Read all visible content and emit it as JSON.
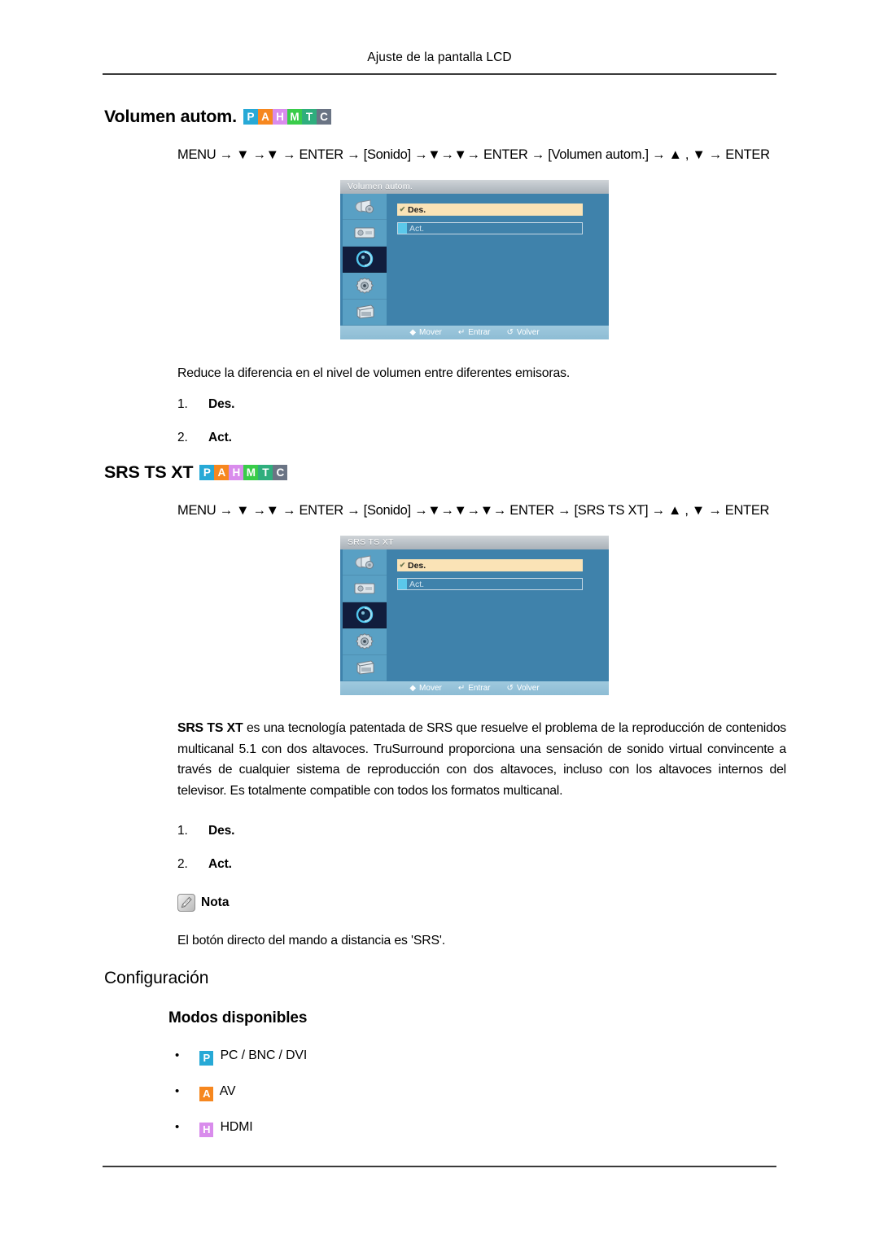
{
  "page": {
    "header": "Ajuste de la pantalla LCD"
  },
  "sections": [
    {
      "id": "volumen-autom",
      "title": "Volumen autom.",
      "badges": [
        {
          "letter": "P",
          "color": "#27a9d6"
        },
        {
          "letter": "A",
          "color": "#f6871f"
        },
        {
          "letter": "H",
          "color": "#d98cec"
        },
        {
          "letter": "M",
          "color": "#39cc4a"
        },
        {
          "letter": "T",
          "color": "#2fae7d"
        },
        {
          "letter": "C",
          "color": "#6a7484"
        }
      ],
      "menu_path": "MENU → ▼ →▼ → ENTER → [Sonido] →▼→▼→ ENTER → [Volumen autom.] → ▲ , ▼ → ENTER",
      "description": "Reduce la diferencia en el nivel de volumen entre diferentes emisoras.",
      "steps": [
        {
          "num": "1.",
          "label": "Des."
        },
        {
          "num": "2.",
          "label": "Act."
        }
      ],
      "osd": {
        "title": "Volumen autom.",
        "option_on": "Des.",
        "option_off": "Act.",
        "check_glyph": "✔",
        "footer": [
          {
            "icon": "move-icon",
            "glyph": "◆",
            "label": "Mover"
          },
          {
            "icon": "enter-icon",
            "glyph": "↵",
            "label": "Entrar"
          },
          {
            "icon": "return-icon",
            "glyph": "↺",
            "label": "Volver"
          }
        ],
        "sidebar_icons": [
          "picture-icon",
          "image-icon",
          "sound-icon",
          "setup-icon",
          "multicontrol-icon"
        ],
        "selected_sidebar_index": 2
      }
    },
    {
      "id": "srs-ts-xt",
      "title": "SRS TS XT",
      "badges": [
        {
          "letter": "P",
          "color": "#27a9d6"
        },
        {
          "letter": "A",
          "color": "#f6871f"
        },
        {
          "letter": "H",
          "color": "#d98cec"
        },
        {
          "letter": "M",
          "color": "#39cc4a"
        },
        {
          "letter": "T",
          "color": "#2fae7d"
        },
        {
          "letter": "C",
          "color": "#6a7484"
        }
      ],
      "menu_path": "MENU → ▼ →▼ → ENTER → [Sonido] →▼→▼→▼→ ENTER → [SRS TS XT] → ▲ , ▼ → ENTER",
      "description_bold": "SRS TS XT",
      "description": " es una tecnología patentada de SRS que resuelve el problema de la reproducción de contenidos multicanal 5.1 con dos altavoces. TruSurround proporciona una sensación de sonido virtual convincente a través de cualquier sistema de reproducción con dos altavoces, incluso con los altavoces internos del televisor. Es totalmente compatible con todos los formatos multicanal.",
      "steps": [
        {
          "num": "1.",
          "label": "Des."
        },
        {
          "num": "2.",
          "label": "Act."
        }
      ],
      "note": {
        "icon": "note-pencil-icon",
        "label": "Nota",
        "text": "El botón directo del mando a distancia es 'SRS'."
      },
      "osd": {
        "title": "SRS TS XT",
        "option_on": "Des.",
        "option_off": "Act.",
        "check_glyph": "✔",
        "footer": [
          {
            "icon": "move-icon",
            "glyph": "◆",
            "label": "Mover"
          },
          {
            "icon": "enter-icon",
            "glyph": "↵",
            "label": "Entrar"
          },
          {
            "icon": "return-icon",
            "glyph": "↺",
            "label": "Volver"
          }
        ],
        "sidebar_icons": [
          "picture-icon",
          "image-icon",
          "sound-icon",
          "setup-icon",
          "multicontrol-icon"
        ],
        "selected_sidebar_index": 2
      }
    },
    {
      "id": "configuracion",
      "title": "Configuración",
      "subtitle": "Modos disponibles",
      "modes": [
        {
          "badge": "P",
          "color": "#27a9d6",
          "label": "PC / BNC / DVI"
        },
        {
          "badge": "A",
          "color": "#f6871f",
          "label": "AV"
        },
        {
          "badge": "H",
          "color": "#d98cec",
          "label": "HDMI"
        }
      ]
    }
  ]
}
